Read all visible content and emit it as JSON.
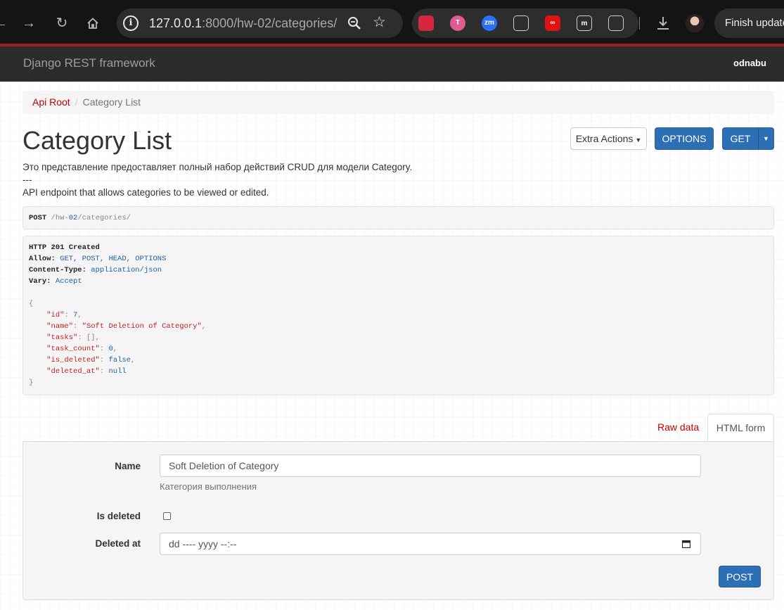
{
  "browser": {
    "url_host": "127.0.0.1",
    "url_rest": ":8000/hw-02/categories/",
    "finish_update_label": "Finish update",
    "extensions": [
      {
        "icon": "mendeley-icon",
        "text": "",
        "color": "#d3283f"
      },
      {
        "icon": "colorful-t-extension-icon",
        "text": "T",
        "color": "#e05b90"
      },
      {
        "icon": "zoom-extension-icon",
        "text": "zm",
        "color": "#2d6ff7"
      },
      {
        "icon": "megaphone-extension-icon",
        "text": "",
        "color": "#2d2d2d"
      },
      {
        "icon": "infinity-extension-icon",
        "text": "∞",
        "color": "#e01212"
      },
      {
        "icon": "m-extension-icon",
        "text": "m",
        "color": "#2d2d2d"
      },
      {
        "icon": "puzzle-extensions-icon",
        "text": "",
        "color": "#2d2d2d"
      }
    ]
  },
  "navbar": {
    "brand": "Django REST framework",
    "user": "odnabu"
  },
  "breadcrumb": {
    "root": "Api Root",
    "separator": "/",
    "current": "Category List"
  },
  "page": {
    "title": "Category List",
    "extra_actions_label": "Extra Actions",
    "options_label": "OPTIONS",
    "get_label": "GET",
    "description": [
      "Это представление предоставляет полный набор действий CRUD для модели Category.",
      "---",
      "API endpoint that allows categories to be viewed or edited."
    ]
  },
  "request": {
    "method": "POST",
    "path_prefix": "/hw-",
    "path_num": "02",
    "path_suffix": "/categories/"
  },
  "response": {
    "status_line": "HTTP 201 Created",
    "headers": [
      {
        "name": "Allow",
        "value": "GET, POST, HEAD, OPTIONS"
      },
      {
        "name": "Content-Type",
        "value": "application/json"
      },
      {
        "name": "Vary",
        "value": "Accept"
      }
    ],
    "body": {
      "open": "{",
      "fields": [
        {
          "key": "\"id\"",
          "value": "7",
          "kind": "num"
        },
        {
          "key": "\"name\"",
          "value": "\"Soft Deletion of Category\"",
          "kind": "str"
        },
        {
          "key": "\"tasks\"",
          "value": "[]",
          "kind": "dim"
        },
        {
          "key": "\"task_count\"",
          "value": "0",
          "kind": "num"
        },
        {
          "key": "\"is_deleted\"",
          "value": "false",
          "kind": "num"
        },
        {
          "key": "\"deleted_at\"",
          "value": "null",
          "kind": "num"
        }
      ],
      "close": "}"
    }
  },
  "form": {
    "tab_raw": "Raw data",
    "tab_html": "HTML form",
    "name_label": "Name",
    "name_value": "Soft Deletion of Category",
    "name_help": "Категория выполнения",
    "is_deleted_label": "Is deleted",
    "is_deleted_checked": false,
    "deleted_at_label": "Deleted at",
    "deleted_at_placeholder": "dd ---- yyyy --:--",
    "submit_label": "POST"
  },
  "colors": {
    "navbar_bg": "#2c2c2c",
    "accent_red": "#c20000",
    "primary_blue": "#2c6fb5"
  }
}
